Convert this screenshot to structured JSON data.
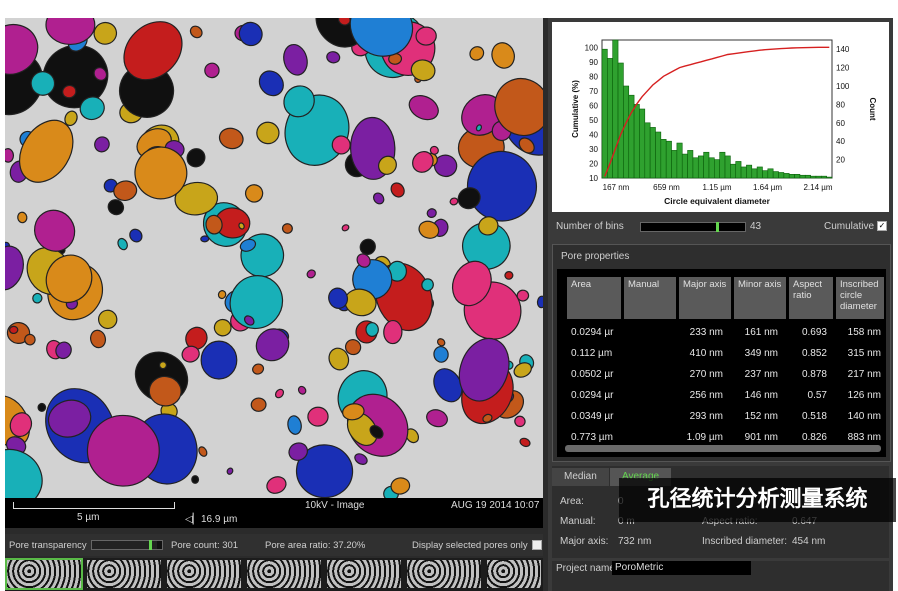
{
  "viewer": {
    "scale_label": "5 µm",
    "hfw_label": "16.9 µm",
    "hfw_icon": "hfw-icon",
    "info_label": "10kV - Image",
    "date_label": "AUG 19 2014 10:07",
    "pore_transparency_label": "Pore transparency",
    "pore_transparency_value": 0.93,
    "pore_count_label": "Pore count: 301",
    "pore_area_label": "Pore area ratio: 37.20%",
    "display_selected_label": "Display selected pores only"
  },
  "chart_data": {
    "type": "bar",
    "xlabel": "Circle equivalent diameter",
    "ylabel_left": "Cumulative (%)",
    "ylabel_right": "Count",
    "x_ticks": [
      "167 nm",
      "659 nm",
      "1.15 µm",
      "1.64 µm",
      "2.14 µm"
    ],
    "y_left_ticks": [
      "10",
      "20",
      "30",
      "40",
      "50",
      "60",
      "70",
      "80",
      "90",
      "100"
    ],
    "y_right_ticks": [
      "20",
      "40",
      "60",
      "80",
      "100",
      "120",
      "140"
    ],
    "ylim_count": [
      0,
      150
    ],
    "ylim_cum": [
      10,
      105
    ],
    "counts": [
      140,
      130,
      150,
      125,
      100,
      90,
      80,
      75,
      60,
      55,
      50,
      42,
      40,
      30,
      38,
      26,
      30,
      22,
      24,
      28,
      22,
      20,
      28,
      24,
      15,
      18,
      12,
      14,
      10,
      12,
      8,
      10,
      7,
      6,
      5,
      4,
      4,
      3,
      3,
      2,
      2,
      2,
      1
    ],
    "cumulative": [
      11,
      20,
      30,
      40,
      48,
      55,
      61,
      66,
      70,
      74,
      77,
      80,
      82,
      84,
      86,
      87,
      88,
      89,
      90,
      91,
      92,
      93,
      94,
      95,
      95.5,
      96,
      96.5,
      97,
      97.5,
      98,
      98.3,
      98.6,
      98.9,
      99.1,
      99.3,
      99.5,
      99.6,
      99.7,
      99.8,
      99.9,
      100,
      100,
      100
    ],
    "colors": {
      "bars": "#2fa12f",
      "bar_edge": "#0a5f0a",
      "cumulative": "#d62020"
    }
  },
  "bins": {
    "label": "Number of bins",
    "value": "43",
    "fraction": 0.72,
    "cumulative_label": "Cumulative",
    "cumulative_checked": true
  },
  "pore_properties": {
    "title": "Pore properties",
    "columns": [
      "Area",
      "Manual",
      "Major axis",
      "Minor axis",
      "Aspect ratio",
      "Inscribed circle diameter"
    ],
    "rows": [
      {
        "area": "0.0294 µr",
        "manual": "",
        "major": "233 nm",
        "minor": "161 nm",
        "aspect": "0.693",
        "inscribed": "158 nm"
      },
      {
        "area": "0.112 µm",
        "manual": "",
        "major": "410 nm",
        "minor": "349 nm",
        "aspect": "0.852",
        "inscribed": "315 nm"
      },
      {
        "area": "0.0502 µr",
        "manual": "",
        "major": "270 nm",
        "minor": "237 nm",
        "aspect": "0.878",
        "inscribed": "217 nm"
      },
      {
        "area": "0.0294 µr",
        "manual": "",
        "major": "256 nm",
        "minor": "146 nm",
        "aspect": "0.57",
        "inscribed": "126 nm"
      },
      {
        "area": "0.0349 µr",
        "manual": "",
        "major": "293 nm",
        "minor": "152 nm",
        "aspect": "0.518",
        "inscribed": "140 nm"
      },
      {
        "area": "0.773 µm",
        "manual": "",
        "major": "1.09 µm",
        "minor": "901 nm",
        "aspect": "0.826",
        "inscribed": "883 nm"
      }
    ]
  },
  "stats": {
    "tab_median": "Median",
    "tab_average": "Average",
    "area_label": "Area:",
    "area_value": "0",
    "manual_label": "Manual:",
    "manual_value": "0 m",
    "major_label": "Major axis:",
    "major_value": "732 nm",
    "aspect_label": "Aspect ratio:",
    "aspect_value": "0.647",
    "inscribed_label": "Inscribed diameter:",
    "inscribed_value": "454 nm"
  },
  "project": {
    "label": "Project name",
    "value": "PoroMetric"
  },
  "caption": "孔径统计分析测量系统"
}
